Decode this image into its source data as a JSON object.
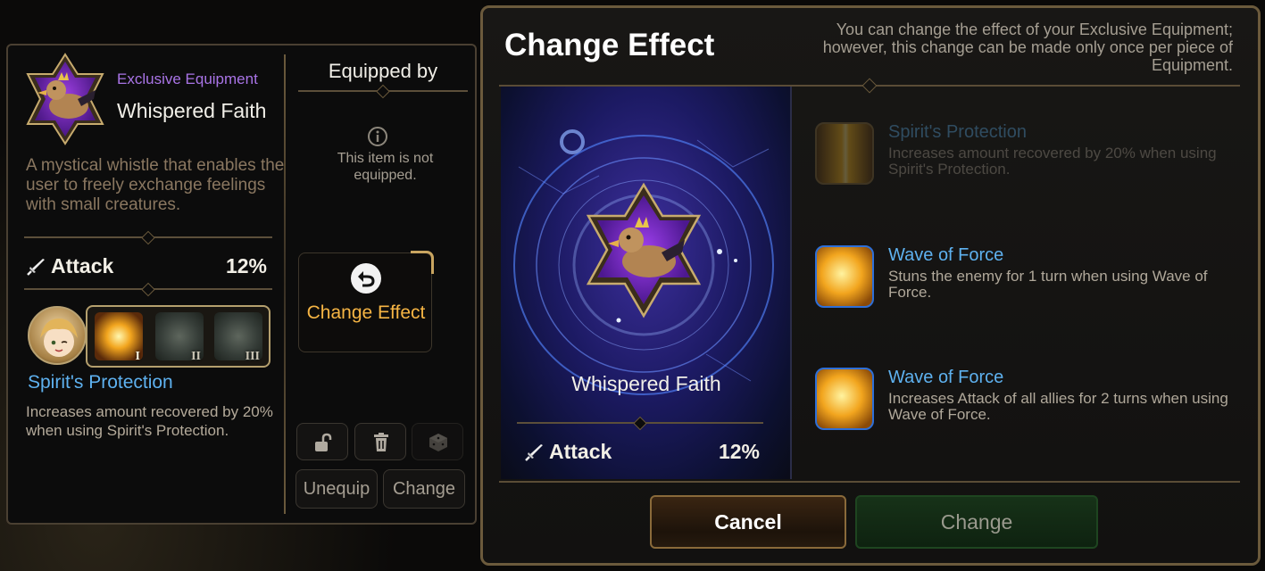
{
  "equipment": {
    "kind": "Exclusive Equipment",
    "name": "Whispered Faith",
    "description": "A mystical whistle that enables the user to freely exchange feelings with small creatures.",
    "stat_name": "Attack",
    "stat_value": "12%"
  },
  "skill": {
    "slots": [
      "I",
      "II",
      "III"
    ],
    "active_slot": "I",
    "title": "Spirit's Protection",
    "description": "Increases amount recovered by 20% when using Spirit's Protection."
  },
  "equipped_by": {
    "title": "Equipped by",
    "status": "This item is not equipped."
  },
  "actions": {
    "change_effect": "Change Effect",
    "unequip": "Unequip",
    "change": "Change"
  },
  "dialog": {
    "title": "Change Effect",
    "note": "You can change the effect of your Exclusive Equipment; however, this change can be made only once per piece of Equipment.",
    "preview_name": "Whispered Faith",
    "stat_name": "Attack",
    "stat_value": "12%",
    "options": [
      {
        "name": "Spirit's Protection",
        "description": "Increases amount recovered by 20% when using Spirit's Protection.",
        "state": "current"
      },
      {
        "name": "Wave of Force",
        "description": "Stuns the enemy for 1 turn when using Wave of Force.",
        "state": "available"
      },
      {
        "name": "Wave of Force",
        "description": "Increases Attack of all allies for 2 turns when using Wave of Force.",
        "state": "available"
      }
    ],
    "cancel": "Cancel",
    "confirm": "Change"
  },
  "colors": {
    "accent_gold": "#f6b544",
    "skill_blue": "#5eb1ef",
    "exclusive_purple": "#a974e6"
  },
  "icons": [
    "duck-whistle-icon",
    "sword-icon",
    "info-icon",
    "undo-icon",
    "unlock-icon",
    "trash-icon",
    "dice-icon"
  ]
}
